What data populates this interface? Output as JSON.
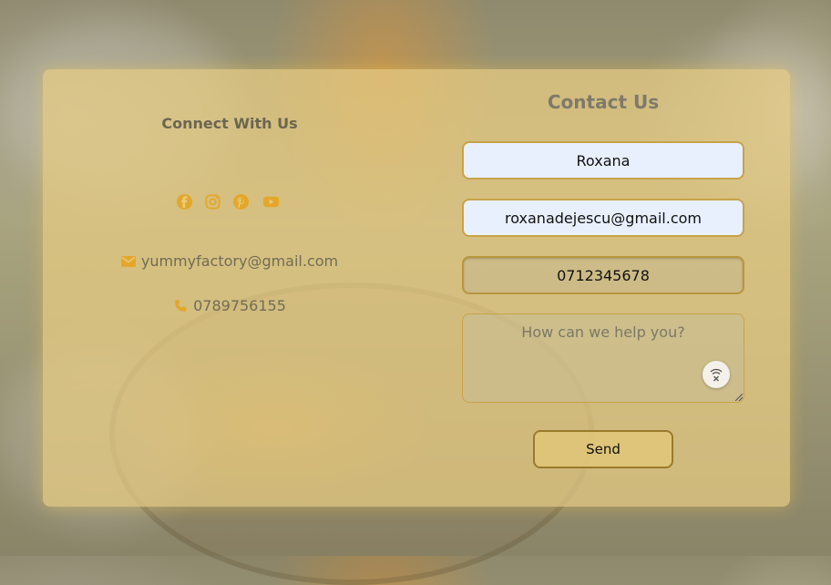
{
  "connect": {
    "title": "Connect With Us",
    "social_icons": [
      "facebook-icon",
      "instagram-icon",
      "pinterest-icon",
      "youtube-icon"
    ],
    "email": "yummyfactory@gmail.com",
    "phone": "0789756155"
  },
  "form": {
    "title": "Contact Us",
    "name_value": "Roxana",
    "email_value": "roxanadejescu@gmail.com",
    "phone_value": "0712345678",
    "message_placeholder": "How can we help you?",
    "send_label": "Send"
  },
  "colors": {
    "accent": "#e3a82b",
    "card": "#e8cc82",
    "autofill": "#e8f0fe"
  }
}
